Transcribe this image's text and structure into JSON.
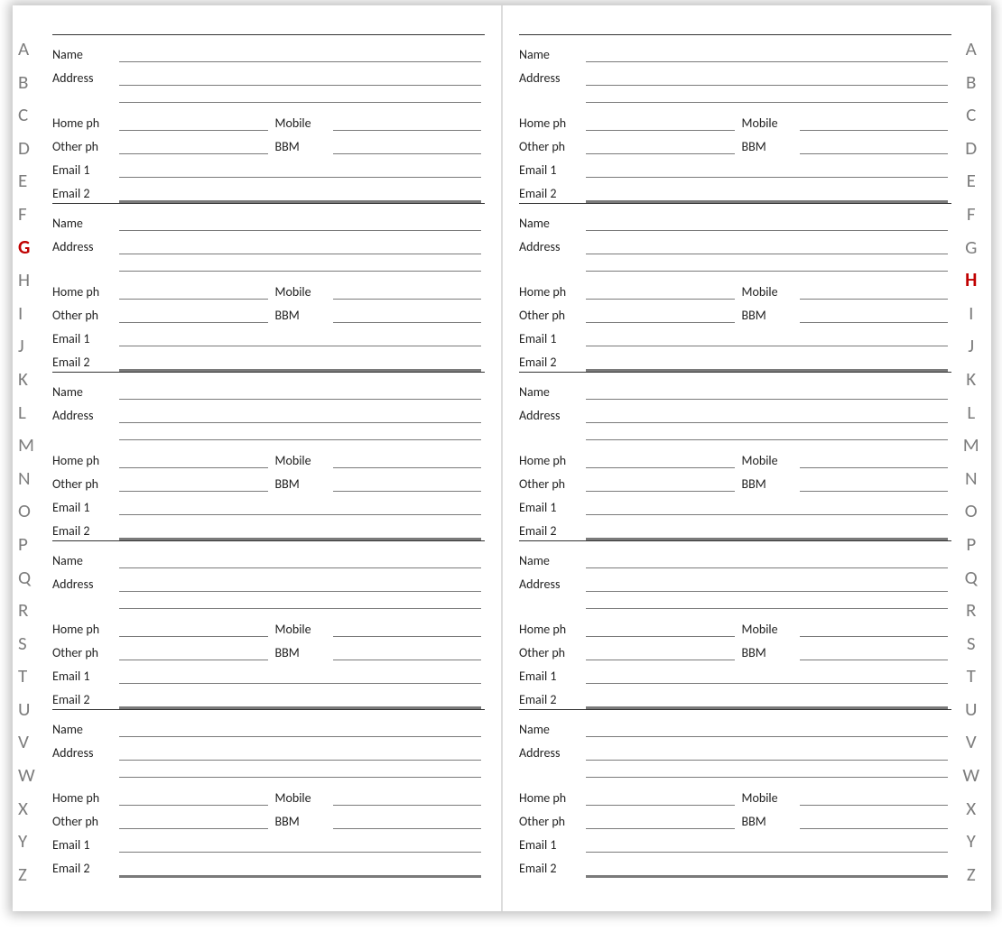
{
  "alphabet": [
    "A",
    "B",
    "C",
    "D",
    "E",
    "F",
    "G",
    "H",
    "I",
    "J",
    "K",
    "L",
    "M",
    "N",
    "O",
    "P",
    "Q",
    "R",
    "S",
    "T",
    "U",
    "V",
    "W",
    "X",
    "Y",
    "Z"
  ],
  "left_selected": "G",
  "right_selected": "H",
  "labels": {
    "name": "Name",
    "address": "Address",
    "home_ph": "Home ph",
    "mobile": "Mobile",
    "other_ph": "Other ph",
    "bbm": "BBM",
    "email1": "Email 1",
    "email2": "Email 2"
  },
  "entries_per_page": 5
}
